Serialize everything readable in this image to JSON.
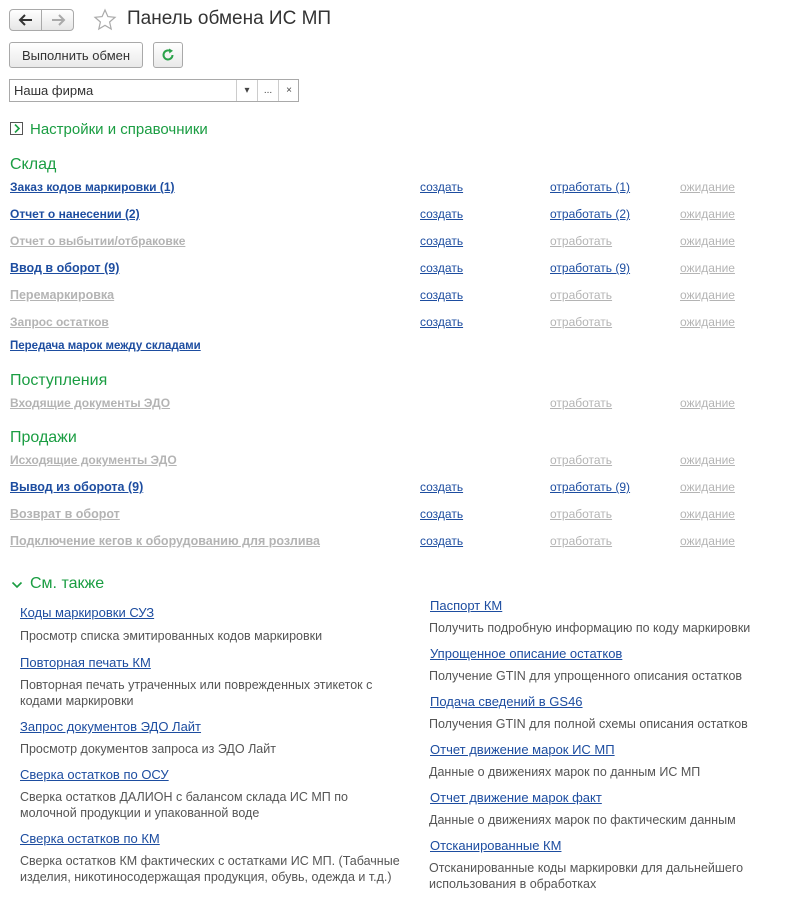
{
  "header": {
    "title": "Панель обмена ИС МП"
  },
  "toolbar": {
    "exchange_label": "Выполнить обмен"
  },
  "org_select": {
    "value": "Наша фирма",
    "dropdown_glyph": "▾",
    "choose_glyph": "...",
    "clear_glyph": "×"
  },
  "settings_label": "Настройки и справочники",
  "sections": {
    "sklad": "Склад",
    "postupleniya": "Поступления",
    "prodazhi": "Продажи"
  },
  "sklad_rows": [
    {
      "doc": "Заказ кодов маркировки (1)",
      "create": "создать",
      "process": "отработать (1)",
      "wait": "ожидание"
    },
    {
      "doc": "Отчет о нанесении (2)",
      "create": "создать",
      "process": "отработать (2)",
      "wait": "ожидание"
    },
    {
      "doc": "Отчет о выбытии/отбраковке",
      "create": "создать",
      "process": "отработать",
      "wait": "ожидание"
    },
    {
      "doc": "Ввод в оборот (9)",
      "create": "создать",
      "process": "отработать (9)",
      "wait": "ожидание"
    },
    {
      "doc": "Перемаркировка",
      "create": "создать",
      "process": "отработать",
      "wait": "ожидание"
    },
    {
      "doc": "Запрос остатков",
      "create": "создать",
      "process": "отработать",
      "wait": "ожидание"
    },
    {
      "doc": "Передача марок между складами"
    }
  ],
  "postupleniya_rows": [
    {
      "doc": "Входящие документы ЭДО",
      "process": "отработать",
      "wait": "ожидание"
    }
  ],
  "prodazhi_rows": [
    {
      "doc": "Исходящие документы ЭДО",
      "process": "отработать",
      "wait": "ожидание"
    },
    {
      "doc": "Вывод из оборота (9)",
      "create": "создать",
      "process": "отработать (9)",
      "wait": "ожидание"
    },
    {
      "doc": "Возврат в оборот",
      "create": "создать",
      "process": "отработать",
      "wait": "ожидание"
    },
    {
      "doc": "Подключение кегов к оборудованию для розлива",
      "create": "создать",
      "process": "отработать",
      "wait": "ожидание"
    }
  ],
  "see_also": {
    "title": "См. также",
    "left": [
      {
        "link": "Коды маркировки СУЗ",
        "desc": "Просмотр списка эмитированных кодов маркировки"
      },
      {
        "link": "Повторная печать КМ",
        "desc": "Повторная печать утраченных или поврежденных этикеток с кодами маркировки"
      },
      {
        "link": "Запрос документов ЭДО Лайт",
        "desc": "Просмотр документов запроса из ЭДО Лайт"
      },
      {
        "link": "Сверка остатков по ОСУ",
        "desc": "Сверка остатков ДАЛИОН с балансом склада ИС МП по молочной продукции и упакованной воде"
      },
      {
        "link": "Сверка остатков по КМ",
        "desc": "Сверка остатков КМ фактических с остатками ИС МП. (Табачные изделия, никотиносодержащая продукция, обувь, одежда и т.д.)"
      }
    ],
    "right": [
      {
        "link": "Паспорт КМ",
        "desc": "Получить подробную информацию по коду маркировки"
      },
      {
        "link": "Упрощенное описание остатков",
        "desc": "Получение GTIN для упрощенного описания остатков"
      },
      {
        "link": "Подача сведений в GS46",
        "desc": "Получения GTIN для полной схемы описания остатков"
      },
      {
        "link": "Отчет движение марок ИС МП",
        "desc": "Данные о движениях марок по данным ИС МП"
      },
      {
        "link": "Отчет движение марок факт",
        "desc": "Данные о движениях марок по фактическим данным"
      },
      {
        "link": "Отсканированные КМ",
        "desc": "Отсканированные коды маркировки для дальнейшего использования в обработках"
      }
    ]
  },
  "colors": {
    "accent_green": "#1a9d42",
    "link_blue": "#1d4da0",
    "disabled_gray": "#b4b4b4"
  }
}
